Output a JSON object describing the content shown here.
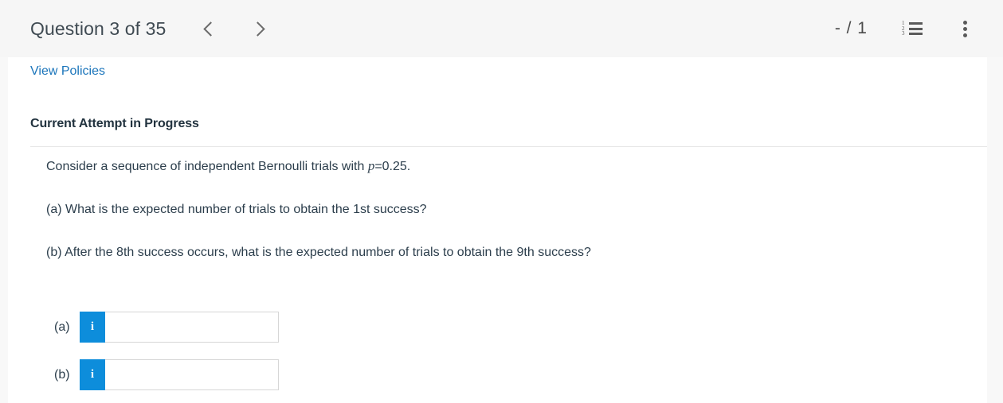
{
  "header": {
    "question_title": "Question 3 of 35",
    "prev_label": "chevron-left",
    "next_label": "chevron-right",
    "score": "- / 1",
    "list_icon": "numbered-list-icon",
    "menu_icon": "kebab-menu-icon"
  },
  "content": {
    "policies_link": "View Policies",
    "attempt_heading": "Current Attempt in Progress",
    "question": {
      "intro_before_var": "Consider a sequence of independent Bernoulli trials with ",
      "intro_var": "p",
      "intro_after_var": "=0.25.",
      "part_a": "(a) What is the expected number of trials to obtain the 1st success?",
      "part_b": "(b) After the 8th success occurs, what is the expected number of trials to obtain the 9th success?"
    },
    "answers": [
      {
        "label": "(a)",
        "info_glyph": "i",
        "value": "",
        "placeholder": ""
      },
      {
        "label": "(b)",
        "info_glyph": "i",
        "value": "",
        "placeholder": ""
      }
    ]
  },
  "colors": {
    "link": "#1b75bb",
    "info_button": "#0d8ddb",
    "header_bg": "#f6f6f6",
    "page_bg": "#f8f8f8",
    "text": "#2c3e4c",
    "heading": "#22333f"
  }
}
